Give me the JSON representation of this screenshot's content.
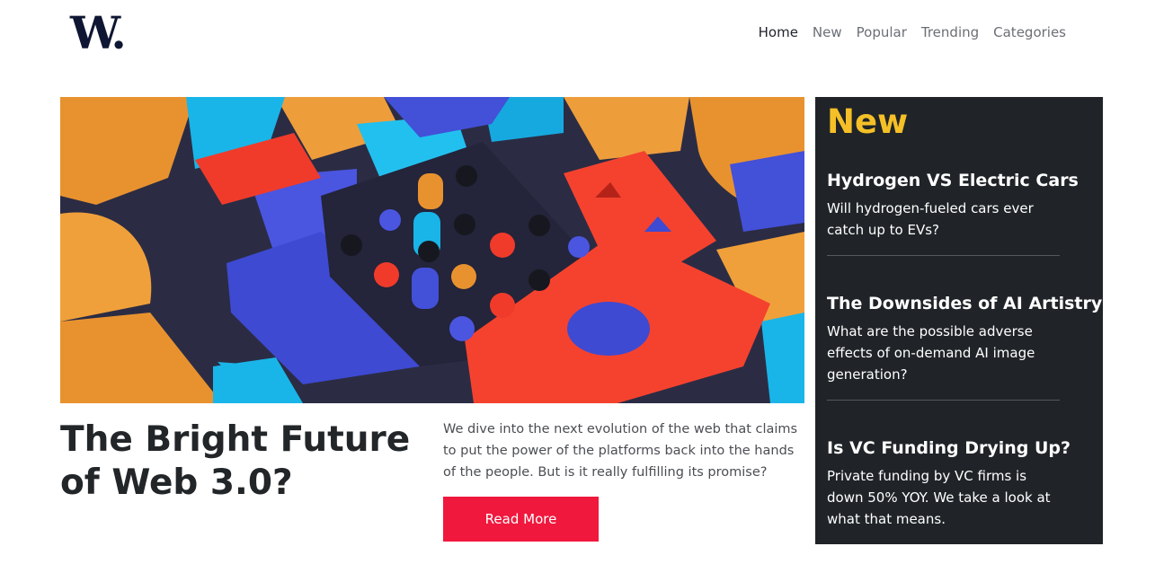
{
  "brand": {
    "logo_text": "W."
  },
  "nav": {
    "items": [
      {
        "label": "Home",
        "active": true
      },
      {
        "label": "New",
        "active": false
      },
      {
        "label": "Popular",
        "active": false
      },
      {
        "label": "Trending",
        "active": false
      },
      {
        "label": "Categories",
        "active": false
      }
    ]
  },
  "hero": {
    "image_icon": "abstract-3d-blocks-image",
    "title": "The Bright Future of Web 3.0?",
    "summary": "We dive into the next evolution of the web that claims to put the power of the platforms back into the hands of the people. But is it really fulfilling its promise?",
    "read_more_label": "Read More"
  },
  "sidebar": {
    "title": "New",
    "items": [
      {
        "title": "Hydrogen VS Electric Cars",
        "text": "Will hydrogen-fueled cars ever catch up to EVs?"
      },
      {
        "title": "The Downsides of AI Artistry",
        "text": "What are the possible adverse effects of on-demand AI image generation?"
      },
      {
        "title": "Is VC Funding Drying Up?",
        "text": "Private funding by VC firms is down 50% YOY. We take a look at what that means."
      }
    ]
  },
  "colors": {
    "accent_red": "#f0183d",
    "sidebar_bg": "#202428",
    "sidebar_title": "#f5c027",
    "logo": "#0f1633"
  }
}
